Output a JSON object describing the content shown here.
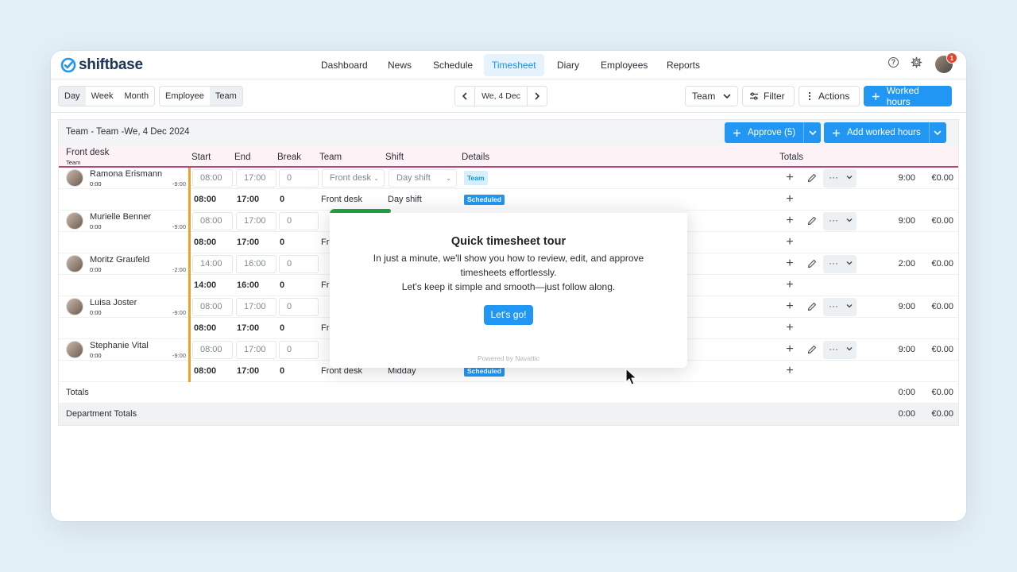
{
  "brand": {
    "name": "shiftbase",
    "accent": "#2196f3"
  },
  "nav": {
    "items": [
      {
        "label": "Dashboard"
      },
      {
        "label": "News"
      },
      {
        "label": "Schedule"
      },
      {
        "label": "Timesheet",
        "active": true
      },
      {
        "label": "Diary"
      },
      {
        "label": "Employees"
      },
      {
        "label": "Reports"
      }
    ],
    "notification_count": "1"
  },
  "toolbar": {
    "period_tabs": [
      "Day",
      "Week",
      "Month"
    ],
    "view_tabs": [
      "Employee",
      "Team"
    ],
    "date": "We, 4 Dec",
    "team_select": "Team",
    "filter": "Filter",
    "actions": "Actions",
    "worked_hours": "Worked hours"
  },
  "section": {
    "title": "Team - Team -We, 4 Dec 2024",
    "approve": "Approve (5)",
    "add_worked_hours": "Add worked hours"
  },
  "table": {
    "department": "Front desk",
    "department_sub": "Team",
    "columns": {
      "start": "Start",
      "end": "End",
      "break": "Break",
      "team": "Team",
      "shift": "Shift",
      "details": "Details",
      "totals": "Totals"
    },
    "employees": [
      {
        "name": "Ramona Erismann",
        "worked": "0:00",
        "diff": "-9:00",
        "edit": {
          "start": "08:00",
          "end": "17:00",
          "break": "0",
          "team": "Front desk",
          "shift": "Day shift",
          "badge": "Team",
          "total_h": "9:00",
          "total_e": "€0.00"
        },
        "sched": {
          "start": "08:00",
          "end": "17:00",
          "break": "0",
          "team": "Front desk",
          "shift": "Day shift",
          "badge": "Scheduled"
        }
      },
      {
        "name": "Murielle Benner",
        "worked": "0:00",
        "diff": "-9:00",
        "edit": {
          "start": "08:00",
          "end": "17:00",
          "break": "0",
          "total_h": "9:00",
          "total_e": "€0.00"
        },
        "sched": {
          "start": "08:00",
          "end": "17:00",
          "break": "0",
          "team": "Fr"
        }
      },
      {
        "name": "Moritz Graufeld",
        "worked": "0:00",
        "diff": "-2:00",
        "edit": {
          "start": "14:00",
          "end": "16:00",
          "break": "0",
          "total_h": "2:00",
          "total_e": "€0.00"
        },
        "sched": {
          "start": "14:00",
          "end": "16:00",
          "break": "0",
          "team": "Fr"
        }
      },
      {
        "name": "Luisa Joster",
        "worked": "0:00",
        "diff": "-9:00",
        "edit": {
          "start": "08:00",
          "end": "17:00",
          "break": "0",
          "total_h": "9:00",
          "total_e": "€0.00"
        },
        "sched": {
          "start": "08:00",
          "end": "17:00",
          "break": "0",
          "team": "Fr"
        }
      },
      {
        "name": "Stephanie Vital",
        "worked": "0:00",
        "diff": "-9:00",
        "edit": {
          "start": "08:00",
          "end": "17:00",
          "break": "0",
          "total_h": "9:00",
          "total_e": "€0.00"
        },
        "sched": {
          "start": "08:00",
          "end": "17:00",
          "break": "0",
          "team": "Front desk",
          "shift": "Midday",
          "badge": "Scheduled"
        }
      }
    ],
    "totals": {
      "label": "Totals",
      "hours": "0:00",
      "euro": "€0.00"
    },
    "dept_totals": {
      "label": "Department Totals",
      "hours": "0:00",
      "euro": "€0.00"
    }
  },
  "modal": {
    "title": "Quick timesheet tour",
    "line1": "In just a minute, we'll show you how to review, edit, and approve timesheets effortlessly.",
    "line2": "Let's keep it simple and smooth—just follow along.",
    "button": "Let's go!",
    "footer": "Powered by Navattic"
  }
}
